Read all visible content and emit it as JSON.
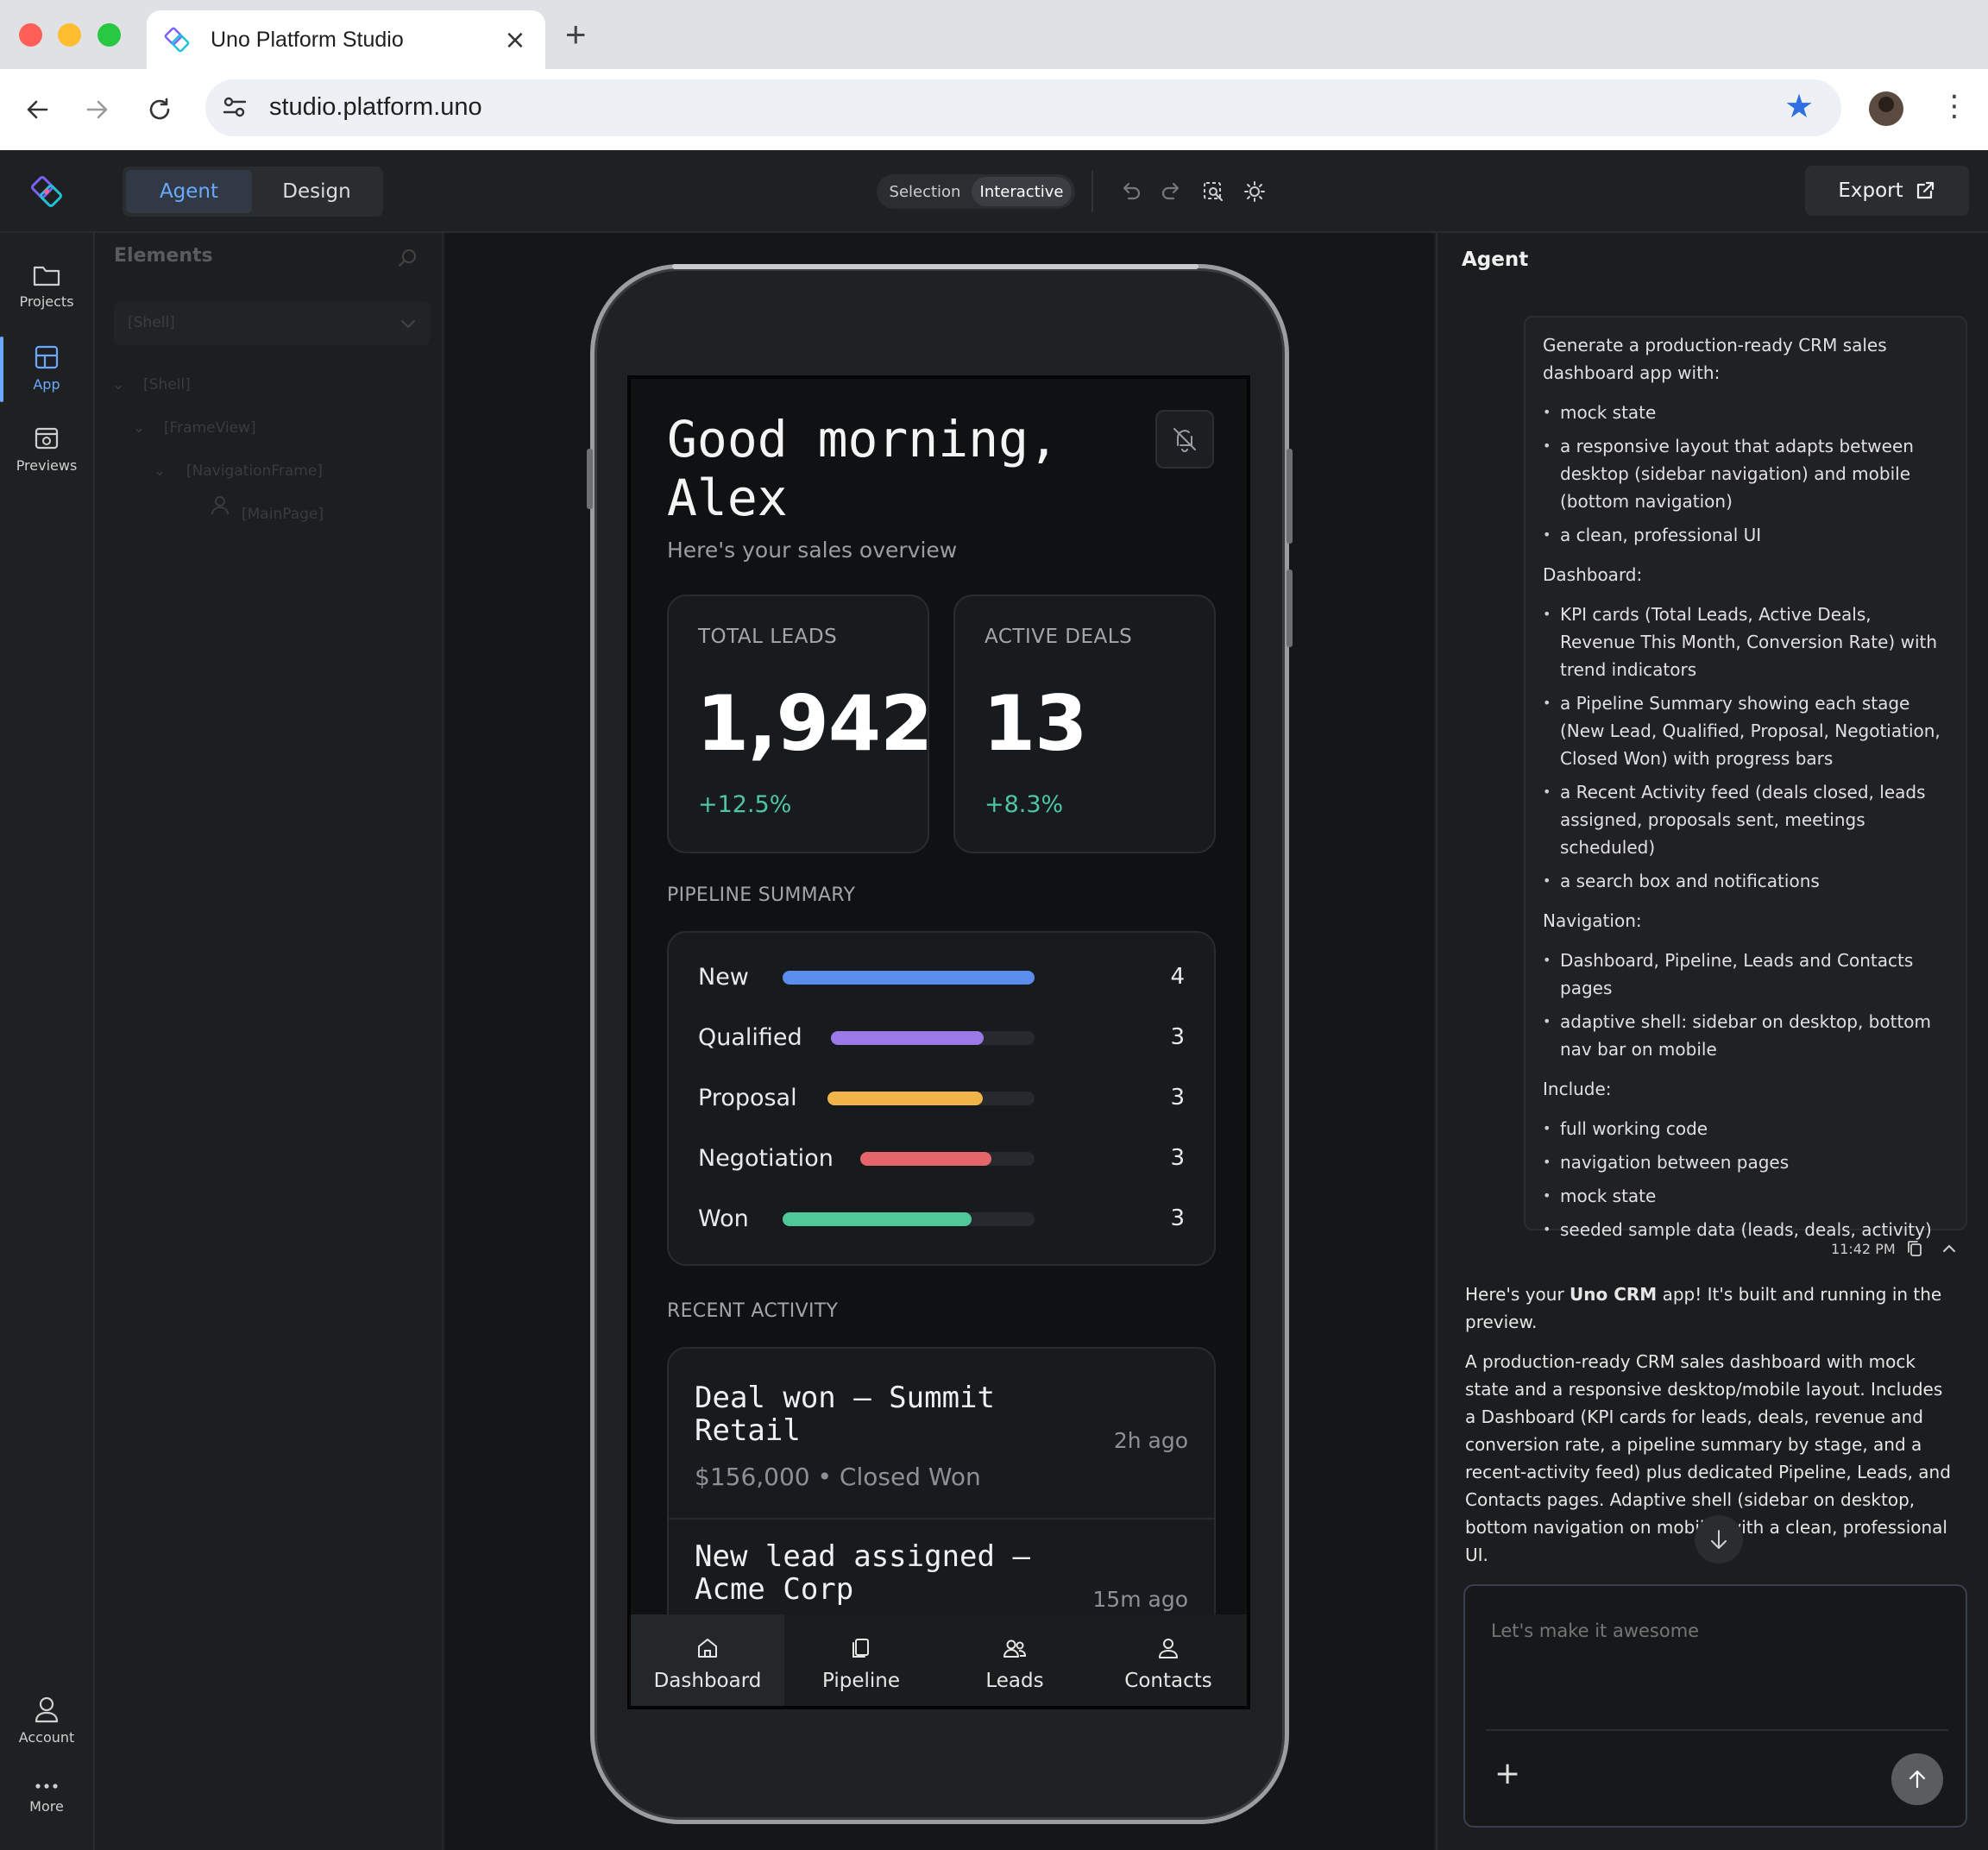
{
  "browser": {
    "tab_title": "Uno Platform Studio",
    "tab_close": "×",
    "new_tab": "+",
    "url": "studio.platform.uno",
    "star_icon": "star-icon",
    "accent": "#2f6fe4"
  },
  "appbar": {
    "mode_agent": "Agent",
    "mode_design": "Design",
    "mode_selection": "Selection",
    "mode_interactive": "Interactive",
    "export_label": "Export",
    "accent": "#6aa9ff"
  },
  "rail": {
    "projects": "Projects",
    "app": "App",
    "previews": "Previews",
    "account": "Account",
    "more": "More"
  },
  "elements": {
    "title": "Elements",
    "combo_value": "[Shell]",
    "tree": [
      "[Shell]",
      "[FrameView]",
      "[NavigationFrame]",
      "[MainPage]"
    ]
  },
  "device": {
    "greeting": "Good morning, Alex",
    "subtitle": "Here's your sales overview",
    "kpis": [
      {
        "label": "TOTAL LEADS",
        "value": "1,942",
        "trend": "+12.5%"
      },
      {
        "label": "ACTIVE DEALS",
        "value": "13",
        "trend": "+8.3%"
      }
    ],
    "pipeline_label": "PIPELINE SUMMARY",
    "pipeline": [
      {
        "stage": "New",
        "count": "4",
        "fill_percent": 100,
        "color": "#5b8def"
      },
      {
        "stage": "Qualified",
        "count": "3",
        "fill_percent": 75,
        "color": "#9b7ae8"
      },
      {
        "stage": "Proposal",
        "count": "3",
        "fill_percent": 75,
        "color": "#f0b44a"
      },
      {
        "stage": "Negotiation",
        "count": "3",
        "fill_percent": 75,
        "color": "#e4666a"
      },
      {
        "stage": "Won",
        "count": "3",
        "fill_percent": 75,
        "color": "#4fc99a"
      }
    ],
    "activity_label": "RECENT ACTIVITY",
    "activity": [
      {
        "title": "Deal won — Summit Retail",
        "meta": "$156,000  •  Closed Won",
        "time": "2h ago"
      },
      {
        "title": "New lead assigned — Acme Corp",
        "meta": "",
        "time": "15m ago"
      }
    ],
    "nav": [
      "Dashboard",
      "Pipeline",
      "Leads",
      "Contacts"
    ],
    "trend_color": "#4fc4a6"
  },
  "agent": {
    "title": "Agent",
    "prompt_intro": "Generate a production-ready CRM sales dashboard app with:",
    "prompt_list_1": [
      "mock state",
      "a responsive layout that adapts between desktop (sidebar navigation) and mobile (bottom navigation)",
      "a clean, professional UI"
    ],
    "prompt_dashboard": "Dashboard:",
    "prompt_list_2": [
      "KPI cards (Total Leads, Active Deals, Revenue This Month, Conversion Rate) with trend indicators",
      "a Pipeline Summary showing each stage (New Lead, Qualified, Proposal, Negotiation, Closed Won) with progress bars",
      "a Recent Activity feed (deals closed, leads assigned, proposals sent, meetings scheduled)",
      "a search box and notifications"
    ],
    "prompt_navigation": "Navigation:",
    "prompt_list_3": [
      "Dashboard, Pipeline, Leads and Contacts pages",
      "adaptive shell: sidebar on desktop, bottom nav bar on mobile"
    ],
    "prompt_include": "Include:",
    "prompt_list_4": [
      "full working code",
      "navigation between pages",
      "mock state",
      "seeded sample data (leads, deals, activity)"
    ],
    "message_time": "11:42 PM",
    "reply_pre": "Here's your ",
    "reply_bold": "Uno CRM",
    "reply_post": " app! It's built and running in the preview.",
    "reply_p2": "A production-ready CRM sales dashboard with mock state and a responsive desktop/mobile layout. Includes a Dashboard (KPI cards for leads, deals, revenue and conversion rate, a pipeline summary by stage, and a recent-activity feed) plus dedicated Pipeline, Leads, and Contacts pages. Adaptive shell (sidebar on desktop, bottom navigation on mobile) with a clean, professional UI.",
    "composer_placeholder": "Let's make it awesome",
    "composer_plus": "+"
  }
}
